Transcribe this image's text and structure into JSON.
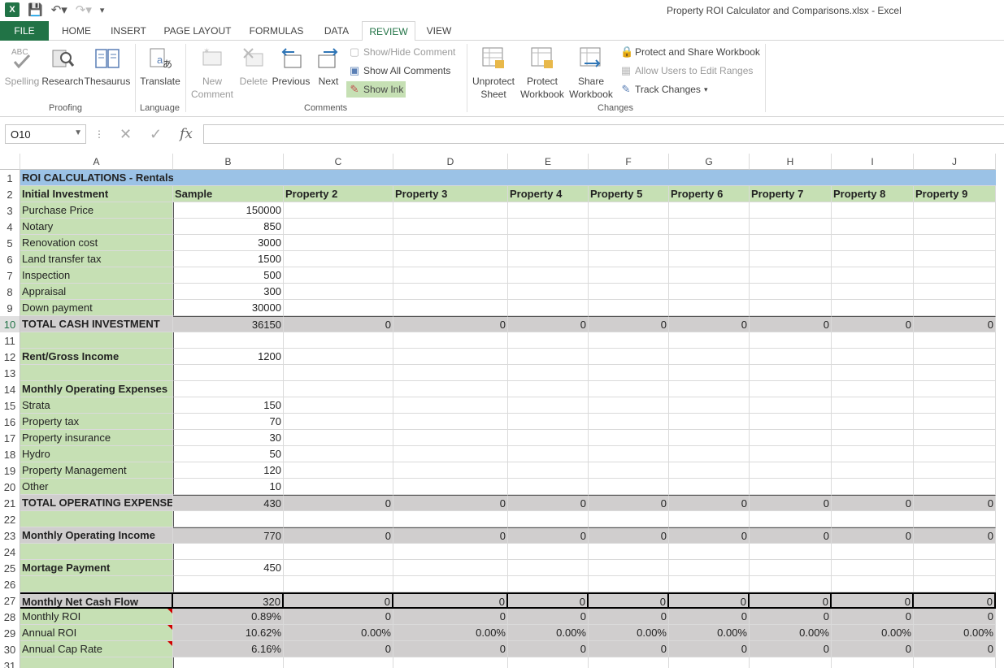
{
  "window": {
    "title": "Property ROI Calculator and Comparisons.xlsx - Excel"
  },
  "qat": {
    "excel_icon_letter": "X",
    "icons": [
      "save-icon",
      "undo-icon",
      "redo-icon",
      "customize-icon"
    ]
  },
  "menu": {
    "file": "FILE",
    "tabs": [
      "HOME",
      "INSERT",
      "PAGE LAYOUT",
      "FORMULAS",
      "DATA",
      "REVIEW",
      "VIEW"
    ],
    "active": "REVIEW"
  },
  "ribbon": {
    "proofing": {
      "spelling": "Spelling",
      "research": "Research",
      "thesaurus": "Thesaurus",
      "label": "Proofing"
    },
    "language": {
      "translate": "Translate",
      "label": "Language"
    },
    "comments": {
      "new_comment_line1": "New",
      "new_comment_line2": "Comment",
      "delete": "Delete",
      "previous": "Previous",
      "next": "Next",
      "show_hide": "Show/Hide Comment",
      "show_all": "Show All Comments",
      "show_ink": "Show Ink",
      "label": "Comments"
    },
    "changes": {
      "unprotect_line1": "Unprotect",
      "unprotect_line2": "Sheet",
      "protect_wb_line1": "Protect",
      "protect_wb_line2": "Workbook",
      "share_line1": "Share",
      "share_line2": "Workbook",
      "protect_share": "Protect and Share Workbook",
      "allow_edit": "Allow Users to Edit Ranges",
      "track_changes": "Track Changes",
      "label": "Changes"
    }
  },
  "formula_bar": {
    "name_box": "O10",
    "formula": ""
  },
  "sheet": {
    "columns": [
      "A",
      "B",
      "C",
      "D",
      "E",
      "F",
      "G",
      "H",
      "I",
      "J"
    ],
    "selected_row": "10",
    "rows": [
      {
        "n": "1",
        "style": "title",
        "cells": [
          "ROI CALCULATIONS - Rentals",
          "",
          "",
          "",
          "",
          "",
          "",
          "",
          "",
          ""
        ]
      },
      {
        "n": "2",
        "style": "header",
        "cells": [
          "Initial Investment",
          "Sample",
          "Property 2",
          "Property 3",
          "Property 4",
          "Property 5",
          "Property 6",
          "Property 7",
          "Property 8",
          "Property 9"
        ]
      },
      {
        "n": "3",
        "style": "data",
        "cells": [
          "Purchase Price",
          "150000",
          "",
          "",
          "",
          "",
          "",
          "",
          "",
          ""
        ]
      },
      {
        "n": "4",
        "style": "data",
        "cells": [
          "Notary",
          "850",
          "",
          "",
          "",
          "",
          "",
          "",
          "",
          ""
        ]
      },
      {
        "n": "5",
        "style": "data",
        "cells": [
          "Renovation cost",
          "3000",
          "",
          "",
          "",
          "",
          "",
          "",
          "",
          ""
        ]
      },
      {
        "n": "6",
        "style": "data",
        "cells": [
          "Land transfer tax",
          "1500",
          "",
          "",
          "",
          "",
          "",
          "",
          "",
          ""
        ]
      },
      {
        "n": "7",
        "style": "data",
        "cells": [
          "Inspection",
          "500",
          "",
          "",
          "",
          "",
          "",
          "",
          "",
          ""
        ]
      },
      {
        "n": "8",
        "style": "data",
        "cells": [
          "Appraisal",
          "300",
          "",
          "",
          "",
          "",
          "",
          "",
          "",
          ""
        ]
      },
      {
        "n": "9",
        "style": "data",
        "cells": [
          "Down payment",
          "30000",
          "",
          "",
          "",
          "",
          "",
          "",
          "",
          ""
        ]
      },
      {
        "n": "10",
        "style": "total",
        "cells": [
          "TOTAL CASH INVESTMENT",
          "36150",
          "0",
          "0",
          "0",
          "0",
          "0",
          "0",
          "0",
          "0"
        ]
      },
      {
        "n": "11",
        "style": "data",
        "cells": [
          "",
          "",
          "",
          "",
          "",
          "",
          "",
          "",
          "",
          ""
        ]
      },
      {
        "n": "12",
        "style": "bold",
        "cells": [
          "Rent/Gross Income",
          "1200",
          "",
          "",
          "",
          "",
          "",
          "",
          "",
          ""
        ]
      },
      {
        "n": "13",
        "style": "data",
        "cells": [
          "",
          "",
          "",
          "",
          "",
          "",
          "",
          "",
          "",
          ""
        ]
      },
      {
        "n": "14",
        "style": "bold",
        "cells": [
          "Monthly Operating Expenses",
          "",
          "",
          "",
          "",
          "",
          "",
          "",
          "",
          ""
        ]
      },
      {
        "n": "15",
        "style": "data",
        "cells": [
          "Strata",
          "150",
          "",
          "",
          "",
          "",
          "",
          "",
          "",
          ""
        ]
      },
      {
        "n": "16",
        "style": "data",
        "cells": [
          "Property tax",
          "70",
          "",
          "",
          "",
          "",
          "",
          "",
          "",
          ""
        ]
      },
      {
        "n": "17",
        "style": "data",
        "cells": [
          "Property insurance",
          "30",
          "",
          "",
          "",
          "",
          "",
          "",
          "",
          ""
        ]
      },
      {
        "n": "18",
        "style": "data",
        "cells": [
          "Hydro",
          "50",
          "",
          "",
          "",
          "",
          "",
          "",
          "",
          ""
        ]
      },
      {
        "n": "19",
        "style": "data",
        "cells": [
          "Property Management",
          "120",
          "",
          "",
          "",
          "",
          "",
          "",
          "",
          ""
        ]
      },
      {
        "n": "20",
        "style": "data",
        "cells": [
          "Other",
          "10",
          "",
          "",
          "",
          "",
          "",
          "",
          "",
          ""
        ]
      },
      {
        "n": "21",
        "style": "total",
        "cells": [
          "TOTAL OPERATING EXPENSES",
          "430",
          "0",
          "0",
          "0",
          "0",
          "0",
          "0",
          "0",
          "0"
        ]
      },
      {
        "n": "22",
        "style": "data",
        "cells": [
          "",
          "",
          "",
          "",
          "",
          "",
          "",
          "",
          "",
          ""
        ]
      },
      {
        "n": "23",
        "style": "total",
        "cells": [
          "Monthly Operating Income",
          "770",
          "0",
          "0",
          "0",
          "0",
          "0",
          "0",
          "0",
          "0"
        ]
      },
      {
        "n": "24",
        "style": "data",
        "cells": [
          "",
          "",
          "",
          "",
          "",
          "",
          "",
          "",
          "",
          ""
        ]
      },
      {
        "n": "25",
        "style": "bold",
        "cells": [
          "Mortage Payment",
          "450",
          "",
          "",
          "",
          "",
          "",
          "",
          "",
          ""
        ]
      },
      {
        "n": "26",
        "style": "data",
        "cells": [
          "",
          "",
          "",
          "",
          "",
          "",
          "",
          "",
          "",
          ""
        ]
      },
      {
        "n": "27",
        "style": "netflow",
        "cells": [
          "Monthly Net Cash Flow",
          "320",
          "0",
          "0",
          "0",
          "0",
          "0",
          "0",
          "0",
          "0"
        ]
      },
      {
        "n": "28",
        "style": "result",
        "cells": [
          "Monthly ROI",
          "0.89%",
          "0",
          "0",
          "0",
          "0",
          "0",
          "0",
          "0",
          "0"
        ]
      },
      {
        "n": "29",
        "style": "result",
        "cells": [
          "Annual ROI",
          "10.62%",
          "0.00%",
          "0.00%",
          "0.00%",
          "0.00%",
          "0.00%",
          "0.00%",
          "0.00%",
          "0.00%"
        ]
      },
      {
        "n": "30",
        "style": "result",
        "cells": [
          "Annual Cap Rate",
          "6.16%",
          "0",
          "0",
          "0",
          "0",
          "0",
          "0",
          "0",
          "0"
        ]
      },
      {
        "n": "31",
        "style": "data",
        "cells": [
          "",
          "",
          "",
          "",
          "",
          "",
          "",
          "",
          "",
          ""
        ]
      }
    ]
  }
}
